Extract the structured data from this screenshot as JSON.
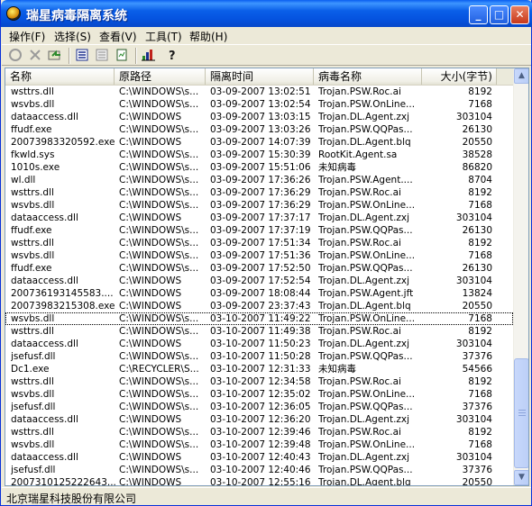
{
  "window": {
    "title": "瑞星病毒隔离系统",
    "minimize_glyph": "_",
    "maximize_glyph": "□",
    "close_glyph": "✕"
  },
  "menu": [
    "操作(F)",
    "选择(S)",
    "查看(V)",
    "工具(T)",
    "帮助(H)"
  ],
  "toolbar": {
    "icons": [
      "circle-icon",
      "delete-icon",
      "restore-icon",
      "list-view-icon",
      "detail-view-icon",
      "report-icon",
      "chart-icon",
      "help-icon"
    ]
  },
  "columns": [
    "名称",
    "原路径",
    "隔离时间",
    "病毒名称",
    "大小(字节)"
  ],
  "rows": [
    [
      "wsttrs.dll",
      "C:\\WINDOWS\\s...",
      "03-09-2007 13:02:51",
      "Trojan.PSW.Roc.ai",
      "8192"
    ],
    [
      "wsvbs.dll",
      "C:\\WINDOWS\\s...",
      "03-09-2007 13:02:54",
      "Trojan.PSW.OnLine...",
      "7168"
    ],
    [
      "dataaccess.dll",
      "C:\\WINDOWS",
      "03-09-2007 13:03:15",
      "Trojan.DL.Agent.zxj",
      "303104"
    ],
    [
      "ffudf.exe",
      "C:\\WINDOWS\\s...",
      "03-09-2007 13:03:26",
      "Trojan.PSW.QQPas...",
      "26130"
    ],
    [
      "20073983320592.exe",
      "C:\\WINDOWS",
      "03-09-2007 14:07:39",
      "Trojan.DL.Agent.blq",
      "20550"
    ],
    [
      "fkwld.sys",
      "C:\\WINDOWS\\s...",
      "03-09-2007 15:30:39",
      "RootKit.Agent.sa",
      "38528"
    ],
    [
      "1010s.exe",
      "C:\\WINDOWS\\s...",
      "03-09-2007 15:51:06",
      "未知病毒",
      "86820"
    ],
    [
      "wl.dll",
      "C:\\WINDOWS\\s...",
      "03-09-2007 17:36:26",
      "Trojan.PSW.Agent....",
      "8704"
    ],
    [
      "wsttrs.dll",
      "C:\\WINDOWS\\s...",
      "03-09-2007 17:36:29",
      "Trojan.PSW.Roc.ai",
      "8192"
    ],
    [
      "wsvbs.dll",
      "C:\\WINDOWS\\s...",
      "03-09-2007 17:36:29",
      "Trojan.PSW.OnLine...",
      "7168"
    ],
    [
      "dataaccess.dll",
      "C:\\WINDOWS",
      "03-09-2007 17:37:17",
      "Trojan.DL.Agent.zxj",
      "303104"
    ],
    [
      "ffudf.exe",
      "C:\\WINDOWS\\s...",
      "03-09-2007 17:37:19",
      "Trojan.PSW.QQPas...",
      "26130"
    ],
    [
      "wsttrs.dll",
      "C:\\WINDOWS\\s...",
      "03-09-2007 17:51:34",
      "Trojan.PSW.Roc.ai",
      "8192"
    ],
    [
      "wsvbs.dll",
      "C:\\WINDOWS\\s...",
      "03-09-2007 17:51:36",
      "Trojan.PSW.OnLine...",
      "7168"
    ],
    [
      "ffudf.exe",
      "C:\\WINDOWS\\s...",
      "03-09-2007 17:52:50",
      "Trojan.PSW.QQPas...",
      "26130"
    ],
    [
      "dataaccess.dll",
      "C:\\WINDOWS",
      "03-09-2007 17:52:54",
      "Trojan.DL.Agent.zxj",
      "303104"
    ],
    [
      "200736193145583....",
      "C:\\WINDOWS",
      "03-09-2007 18:08:44",
      "Trojan.PSW.Agent.jft",
      "13824"
    ],
    [
      "20073983215308.exe",
      "C:\\WINDOWS",
      "03-09-2007 23:37:43",
      "Trojan.DL.Agent.blq",
      "20550"
    ],
    [
      "wsvbs.dll",
      "C:\\WINDOWS\\s...",
      "03-10-2007 11:49:22",
      "Trojan.PSW.OnLine...",
      "7168"
    ],
    [
      "wsttrs.dll",
      "C:\\WINDOWS\\s...",
      "03-10-2007 11:49:38",
      "Trojan.PSW.Roc.ai",
      "8192"
    ],
    [
      "dataaccess.dll",
      "C:\\WINDOWS",
      "03-10-2007 11:50:23",
      "Trojan.DL.Agent.zxj",
      "303104"
    ],
    [
      "jsefusf.dll",
      "C:\\WINDOWS\\s...",
      "03-10-2007 11:50:28",
      "Trojan.PSW.QQPas...",
      "37376"
    ],
    [
      "Dc1.exe",
      "C:\\RECYCLER\\S...",
      "03-10-2007 12:31:33",
      "未知病毒",
      "54566"
    ],
    [
      "wsttrs.dll",
      "C:\\WINDOWS\\s...",
      "03-10-2007 12:34:58",
      "Trojan.PSW.Roc.ai",
      "8192"
    ],
    [
      "wsvbs.dll",
      "C:\\WINDOWS\\s...",
      "03-10-2007 12:35:02",
      "Trojan.PSW.OnLine...",
      "7168"
    ],
    [
      "jsefusf.dll",
      "C:\\WINDOWS\\s...",
      "03-10-2007 12:36:05",
      "Trojan.PSW.QQPas...",
      "37376"
    ],
    [
      "dataaccess.dll",
      "C:\\WINDOWS",
      "03-10-2007 12:36:20",
      "Trojan.DL.Agent.zxj",
      "303104"
    ],
    [
      "wsttrs.dll",
      "C:\\WINDOWS\\s...",
      "03-10-2007 12:39:46",
      "Trojan.PSW.Roc.ai",
      "8192"
    ],
    [
      "wsvbs.dll",
      "C:\\WINDOWS\\s...",
      "03-10-2007 12:39:48",
      "Trojan.PSW.OnLine...",
      "7168"
    ],
    [
      "dataaccess.dll",
      "C:\\WINDOWS",
      "03-10-2007 12:40:43",
      "Trojan.DL.Agent.zxj",
      "303104"
    ],
    [
      "jsefusf.dll",
      "C:\\WINDOWS\\s...",
      "03-10-2007 12:40:46",
      "Trojan.PSW.QQPas...",
      "37376"
    ],
    [
      "2007310125222643...",
      "C:\\WINDOWS",
      "03-10-2007 12:55:16",
      "Trojan.DL.Agent.blq",
      "20550"
    ]
  ],
  "selected_row": 18,
  "scrollbar": {
    "up_glyph": "▲",
    "down_glyph": "▼"
  },
  "status": "北京瑞星科技股份有限公司"
}
